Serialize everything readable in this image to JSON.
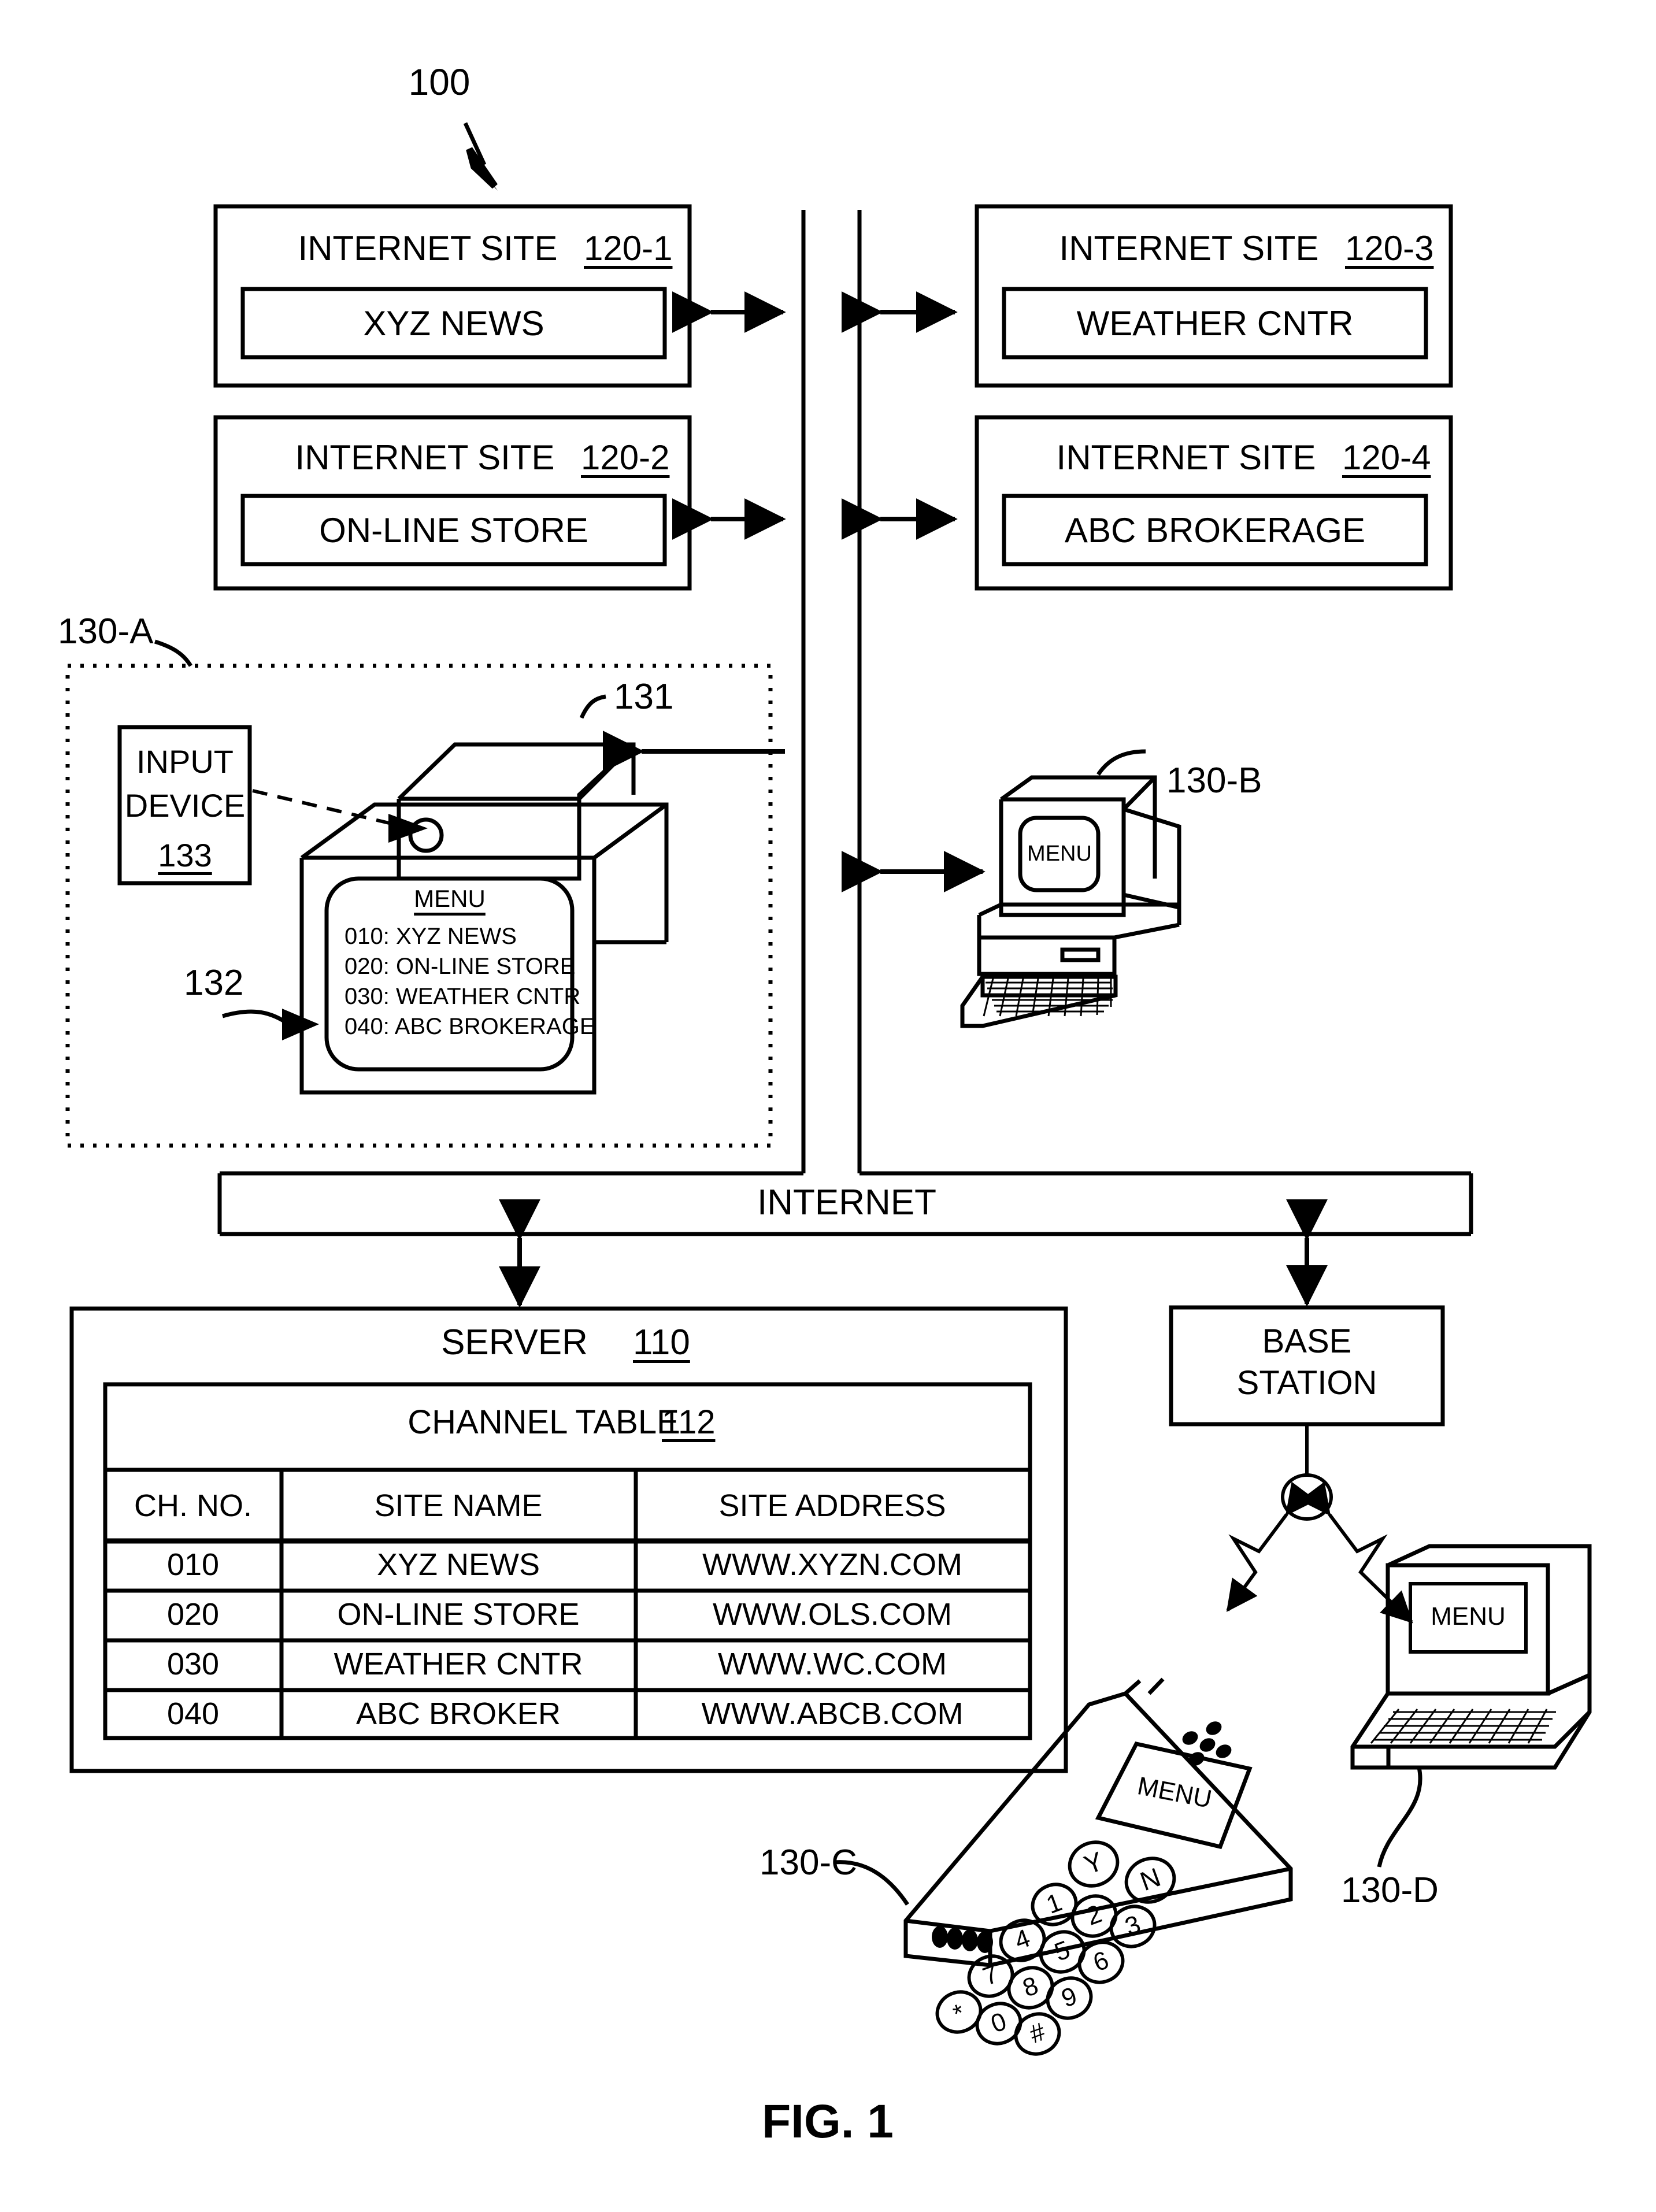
{
  "figure": {
    "caption": "FIG. 1",
    "system_label": "100"
  },
  "internet_sites": [
    {
      "title": "INTERNET SITE",
      "ref": "120-1",
      "name": "XYZ NEWS"
    },
    {
      "title": "INTERNET SITE",
      "ref": "120-2",
      "name": "ON-LINE STORE"
    },
    {
      "title": "INTERNET SITE",
      "ref": "120-3",
      "name": "WEATHER CNTR"
    },
    {
      "title": "INTERNET SITE",
      "ref": "120-4",
      "name": "ABC BROKERAGE"
    }
  ],
  "backbone": {
    "label": "INTERNET"
  },
  "client_a": {
    "ref": "130-A",
    "set_top_box_ref": "131",
    "display_ref": "132",
    "input_device": {
      "line1": "INPUT",
      "line2": "DEVICE",
      "ref": "133"
    },
    "menu": {
      "title": "MENU",
      "items": [
        "010: XYZ NEWS",
        "020: ON-LINE STORE",
        "030: WEATHER CNTR",
        "040: ABC BROKERAGE"
      ]
    }
  },
  "client_b": {
    "ref": "130-B",
    "screen_label": "MENU"
  },
  "client_c": {
    "ref": "130-C",
    "screen_label": "MENU",
    "keys": [
      "Y",
      "N",
      "1",
      "2",
      "3",
      "4",
      "5",
      "6",
      "7",
      "8",
      "9",
      "*",
      "0",
      "#"
    ]
  },
  "client_d": {
    "ref": "130-D",
    "screen_label": "MENU"
  },
  "base_station": {
    "line1": "BASE",
    "line2": "STATION"
  },
  "server": {
    "title": "SERVER",
    "ref": "110",
    "table": {
      "title": "CHANNEL TABLE",
      "ref": "112",
      "columns": [
        "CH. NO.",
        "SITE NAME",
        "SITE ADDRESS"
      ],
      "rows": [
        [
          "010",
          "XYZ NEWS",
          "WWW.XYZN.COM"
        ],
        [
          "020",
          "ON-LINE STORE",
          "WWW.OLS.COM"
        ],
        [
          "030",
          "WEATHER CNTR",
          "WWW.WC.COM"
        ],
        [
          "040",
          "ABC BROKER",
          "WWW.ABCB.COM"
        ]
      ]
    }
  }
}
